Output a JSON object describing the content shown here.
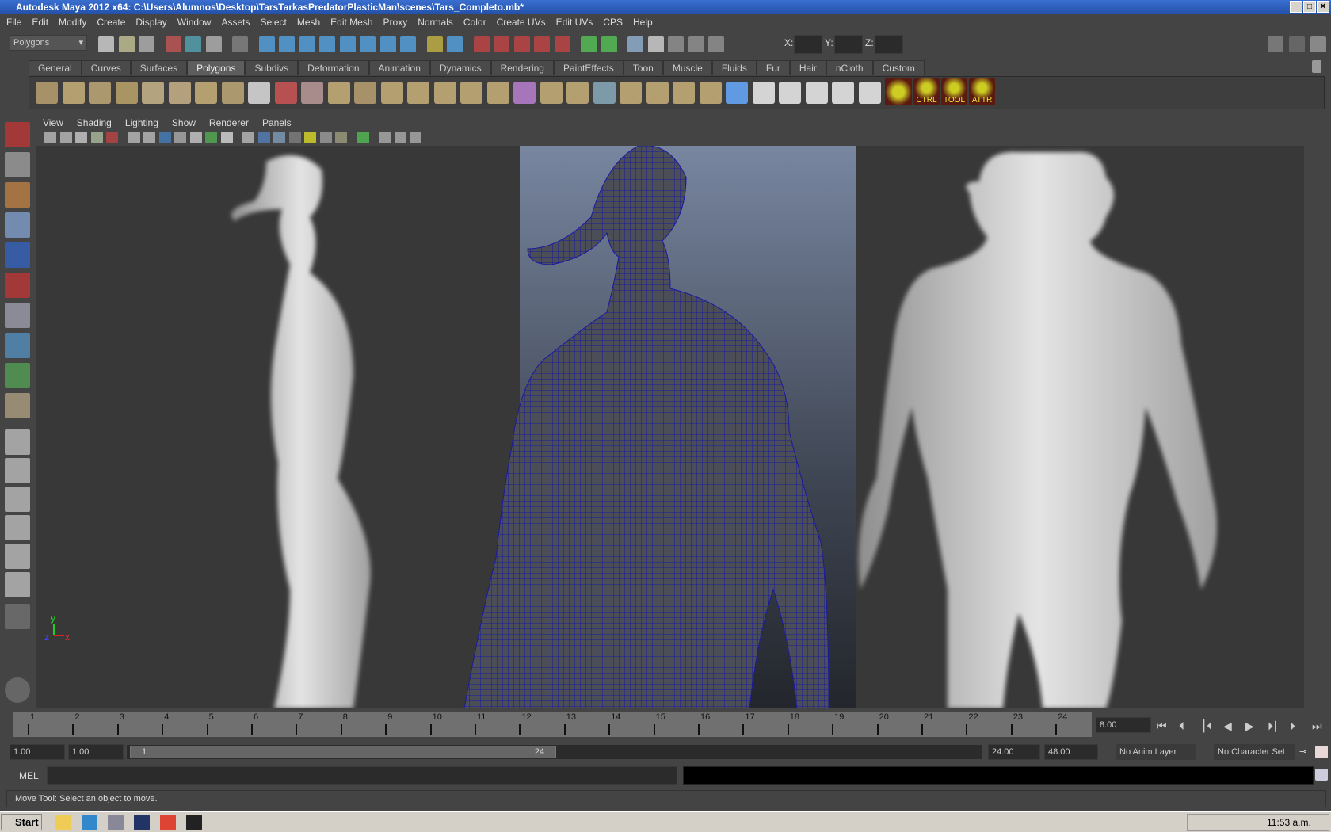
{
  "window": {
    "title": "Autodesk Maya 2012 x64: C:\\Users\\Alumnos\\Desktop\\TarsTarkasPredatorPlasticMan\\scenes\\Tars_Completo.mb*",
    "minimize": "_",
    "maximize": "□",
    "close": "✕"
  },
  "menus": [
    "File",
    "Edit",
    "Modify",
    "Create",
    "Display",
    "Window",
    "Assets",
    "Select",
    "Mesh",
    "Edit Mesh",
    "Proxy",
    "Normals",
    "Color",
    "Create UVs",
    "Edit UVs",
    "CPS",
    "Help"
  ],
  "statusline": {
    "menuset": "Polygons",
    "x_label": "X:",
    "y_label": "Y:",
    "z_label": "Z:",
    "x_value": "",
    "y_value": "",
    "z_value": ""
  },
  "shelf": {
    "tabs": [
      "General",
      "Curves",
      "Surfaces",
      "Polygons",
      "Subdivs",
      "Deformation",
      "Animation",
      "Dynamics",
      "Rendering",
      "PaintEffects",
      "Toon",
      "Muscle",
      "Fluids",
      "Fur",
      "Hair",
      "nCloth",
      "Custom"
    ],
    "active": "Polygons",
    "icons": [
      "poly-sphere-icon",
      "poly-cube-icon",
      "poly-cylinder-icon",
      "poly-cone-icon",
      "poly-plane-icon",
      "poly-torus-icon",
      "poly-pyramid-icon",
      "poly-pipe-icon",
      "poly-soccer-ball-icon",
      "combine-icon",
      "separate-icon",
      "extract-icon",
      "smooth-icon",
      "boolean-icon",
      "mirror-icon",
      "append-polygon-icon",
      "split-polygon-icon",
      "insert-edge-loop-icon",
      "extrude-icon",
      "bridge-icon",
      "bevel-icon",
      "merge-icon",
      "poke-icon",
      "wedge-icon",
      "duplicate-face-icon",
      "plane-projection-icon",
      "cylindrical-projection-icon",
      "automatic-mapping-icon",
      "uv-editor-icon",
      "checker-icon",
      "cut-uv-icon",
      "sew-uv-icon"
    ],
    "custom_buttons": [
      "CTRL",
      "TOOL",
      "ATTR"
    ]
  },
  "panel": {
    "menus": [
      "View",
      "Shading",
      "Lighting",
      "Show",
      "Renderer",
      "Panels"
    ]
  },
  "axis": {
    "x": "x",
    "y": "y",
    "z": "z"
  },
  "timeline": {
    "ticks": [
      "1",
      "2",
      "3",
      "4",
      "5",
      "6",
      "7",
      "8",
      "9",
      "10",
      "11",
      "12",
      "13",
      "14",
      "15",
      "16",
      "17",
      "18",
      "19",
      "20",
      "21",
      "22",
      "23",
      "24"
    ],
    "current_time": "8.00"
  },
  "range": {
    "start_time": "1.00",
    "playback_start": "1.00",
    "range_start": "1",
    "range_end": "24",
    "playback_end": "24.00",
    "end_time": "48.00",
    "anim_layer": "No Anim Layer",
    "character_set": "No Character Set"
  },
  "command": {
    "label": "MEL",
    "value": ""
  },
  "helpline": "Move Tool: Select an object to move.",
  "taskbar": {
    "start": "Start",
    "clock": "11:53 a.m.",
    "apps": [
      "explorer-icon",
      "internet-explorer-icon",
      "after-effects-icon",
      "photoshop-icon",
      "chrome-icon",
      "maya-icon"
    ]
  },
  "colors": {
    "wire": "#1a1aa0",
    "accent": "#5d5d5d"
  }
}
